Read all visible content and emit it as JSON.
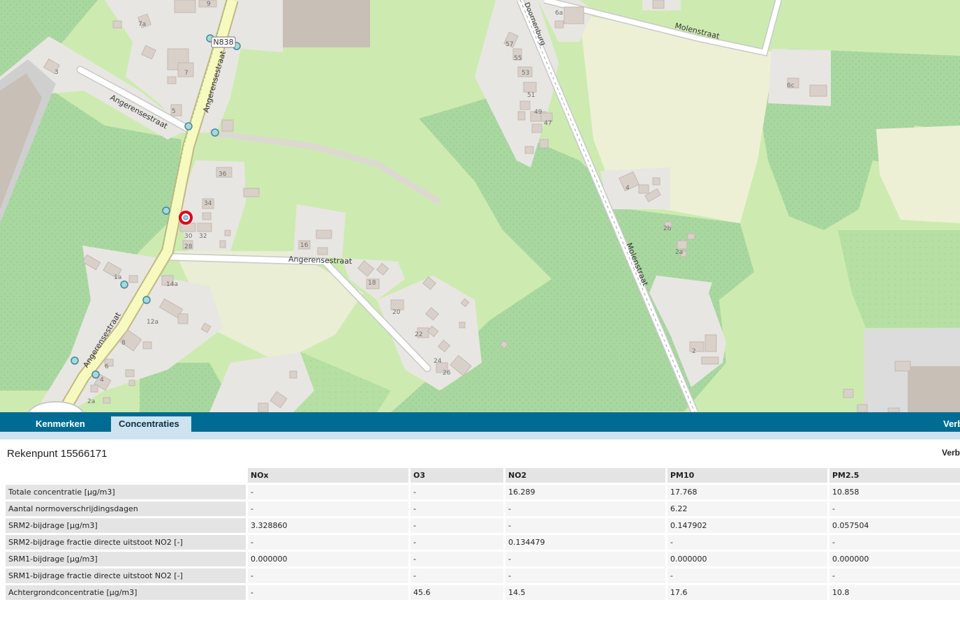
{
  "map": {
    "road_labels": {
      "n838": "N838",
      "angerensestraat_a": "Angerensestraat",
      "angerensestraat_b": "Angerensestraat",
      "angerensestraat_c": "Angerensestraat",
      "angerensestraat_d": "Angerensestraat",
      "molenstraat_a": "Molenstraat",
      "molenstraat_b": "Molenstraat",
      "doornenburg": "Doornenburg"
    },
    "house_numbers": [
      "9",
      "7a",
      "3",
      "7",
      "5",
      "36",
      "34",
      "30",
      "32",
      "28",
      "16",
      "1a",
      "14a",
      "12a",
      "8",
      "6",
      "4",
      "2a",
      "18",
      "20",
      "22",
      "24",
      "26",
      "57",
      "55",
      "53",
      "51",
      "49",
      "47",
      "6a",
      "6c",
      "4",
      "2b",
      "2a",
      "2"
    ],
    "marker_color": "#e0001b"
  },
  "tabs": {
    "kenmerken": "Kenmerken",
    "concentraties": "Concentraties",
    "verb": "Verb"
  },
  "panel": {
    "title": "Rekenpunt 15566171",
    "right_link": "Verb"
  },
  "table": {
    "columns": [
      "NOx",
      "O3",
      "NO2",
      "PM10",
      "PM2.5"
    ],
    "rows": [
      {
        "label": "Totale concentratie [µg/m3]",
        "values": [
          "-",
          "-",
          "16.289",
          "17.768",
          "10.858"
        ]
      },
      {
        "label": "Aantal normoverschrijdingsdagen",
        "values": [
          "-",
          "-",
          "-",
          "6.22",
          "-"
        ]
      },
      {
        "label": "SRM2-bijdrage [µg/m3]",
        "values": [
          "3.328860",
          "-",
          "-",
          "0.147902",
          "0.057504"
        ]
      },
      {
        "label": "SRM2-bijdrage fractie directe uitstoot NO2 [-]",
        "values": [
          "-",
          "-",
          "0.134479",
          "-",
          "-"
        ]
      },
      {
        "label": "SRM1-bijdrage [µg/m3]",
        "values": [
          "0.000000",
          "-",
          "-",
          "0.000000",
          "0.000000"
        ]
      },
      {
        "label": "SRM1-bijdrage fractie directe uitstoot NO2 [-]",
        "values": [
          "-",
          "-",
          "-",
          "-",
          "-"
        ]
      },
      {
        "label": "Achtergrondconcentratie [µg/m3]",
        "values": [
          "-",
          "45.6",
          "14.5",
          "17.6",
          "10.8"
        ]
      }
    ]
  },
  "colors": {
    "tab_bar": "#006c93",
    "active_tab": "#cde3f0",
    "meadow": "#cdebb0",
    "grass": "#b9e2a8",
    "road_primary": "#f7fabf"
  }
}
